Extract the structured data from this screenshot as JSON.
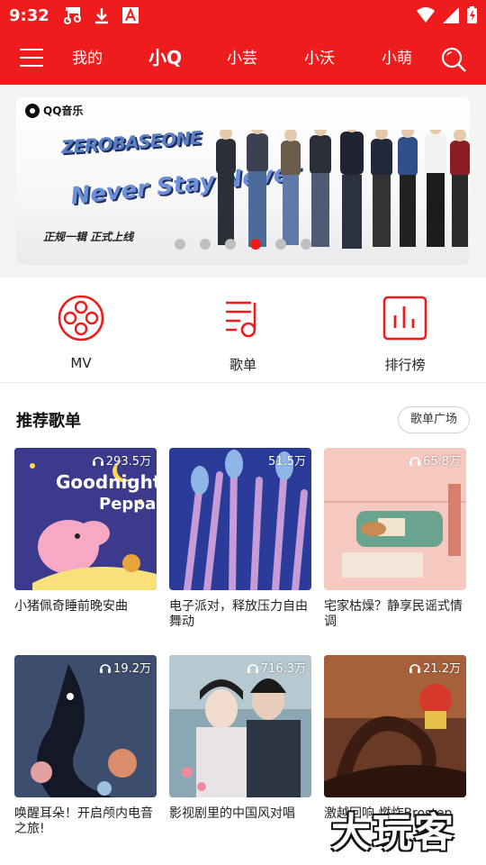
{
  "status": {
    "time": "9:32",
    "icons": [
      "music-note-icon",
      "download-icon",
      "app-a-icon",
      "wifi-icon",
      "signal-icon",
      "battery-icon"
    ]
  },
  "nav": {
    "tabs": [
      {
        "label": "我的",
        "active": false
      },
      {
        "label": "小Q",
        "active": true
      },
      {
        "label": "小芸",
        "active": false
      },
      {
        "label": "小沃",
        "active": false
      },
      {
        "label": "小萌",
        "active": false
      }
    ]
  },
  "banner": {
    "brand": "QQ音乐",
    "title": "ZEROBASEONE",
    "subtitle": "Never Stay Never",
    "tagline": "正规一辑  正式上线",
    "active_index": 3,
    "count": 6
  },
  "quick": [
    {
      "label": "MV",
      "icon": "film-reel-icon"
    },
    {
      "label": "歌单",
      "icon": "playlist-icon"
    },
    {
      "label": "排行榜",
      "icon": "chart-icon"
    }
  ],
  "recommend": {
    "title": "推荐歌单",
    "more_label": "歌单广场",
    "playlists": [
      {
        "title": "小猪佩奇睡前晚安曲",
        "count": "293.5万",
        "cover_text_1": "Goodnight",
        "cover_text_2": "Peppa"
      },
      {
        "title": "电子派对，释放压力自由舞动",
        "count": "51.5万"
      },
      {
        "title": "宅家枯燥？静享民谣式情调",
        "count": "65.8万"
      },
      {
        "title": "唤醒耳朵！开启颅内电音之旅!",
        "count": "19.2万"
      },
      {
        "title": "影视剧里的中国风对唱",
        "count": "716.3万"
      },
      {
        "title": "激越回响 燃炸Brostep",
        "count": "21.2万"
      }
    ]
  },
  "watermark": "大玩客",
  "colors": {
    "accent": "#ee1c1c"
  }
}
